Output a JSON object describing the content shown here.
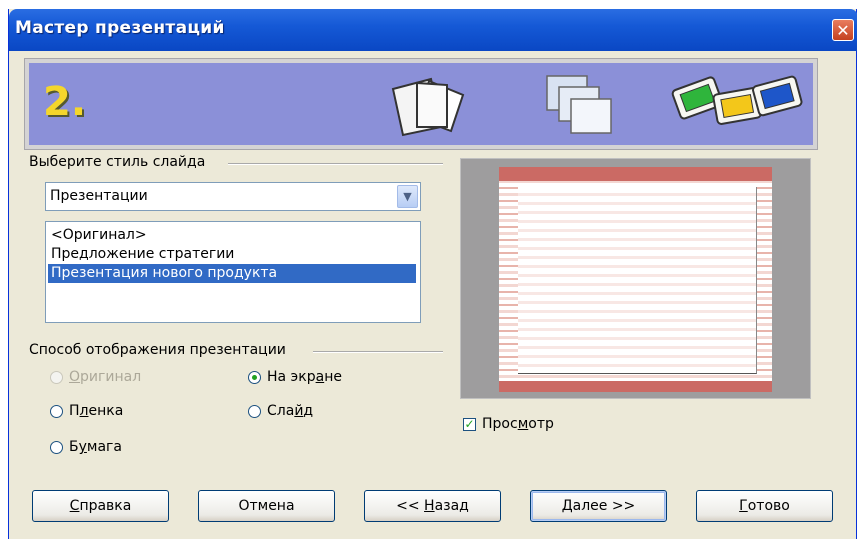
{
  "window": {
    "title": "Мастер презентаций",
    "close_glyph": "✕"
  },
  "banner": {
    "step_number": "2."
  },
  "style_section": {
    "label": "Выберите стиль слайда",
    "category_value": "Презентации",
    "templates": [
      "<Оригинал>",
      "Предложение стратегии",
      "Презентация нового продукта"
    ],
    "selected_index": 2
  },
  "display_section": {
    "label": "Способ отображения презентации",
    "options": [
      {
        "label": "Оригинал",
        "underline": "О",
        "rest": "ригинал",
        "checked": false,
        "disabled": true
      },
      {
        "label": "На экране",
        "pre": "На экр",
        "underline": "а",
        "rest": "не",
        "checked": true,
        "disabled": false
      },
      {
        "label": "Пленка",
        "pre": "П",
        "underline": "л",
        "rest": "енка",
        "checked": false,
        "disabled": false
      },
      {
        "label": "Слайд",
        "pre": "Сла",
        "underline": "й",
        "rest": "д",
        "checked": false,
        "disabled": false
      },
      {
        "label": "Бумага",
        "pre": "Б",
        "underline": "у",
        "rest": "мага",
        "checked": false,
        "disabled": false
      }
    ]
  },
  "preview": {
    "checkbox_pre": "Прос",
    "checkbox_underline": "м",
    "checkbox_rest": "отр",
    "checked": true
  },
  "buttons": {
    "help": {
      "underline": "С",
      "rest": "правка"
    },
    "cancel": "Отмена",
    "back": {
      "pre": "<< ",
      "underline": "Н",
      "rest": "азад"
    },
    "next": {
      "underline": "Д",
      "rest": "алее >>"
    },
    "finish": {
      "underline": "Г",
      "rest": "отово"
    }
  },
  "colors": {
    "title_bar": "#0a47c4",
    "selection": "#316ac5",
    "radio_dot": "#21a121",
    "banner": "#8b90d8",
    "step_number": "#f4d62c"
  },
  "icons": [
    "close-icon",
    "chevron-down-icon",
    "pages-icon",
    "layers-icon",
    "color-slides-icon"
  ]
}
